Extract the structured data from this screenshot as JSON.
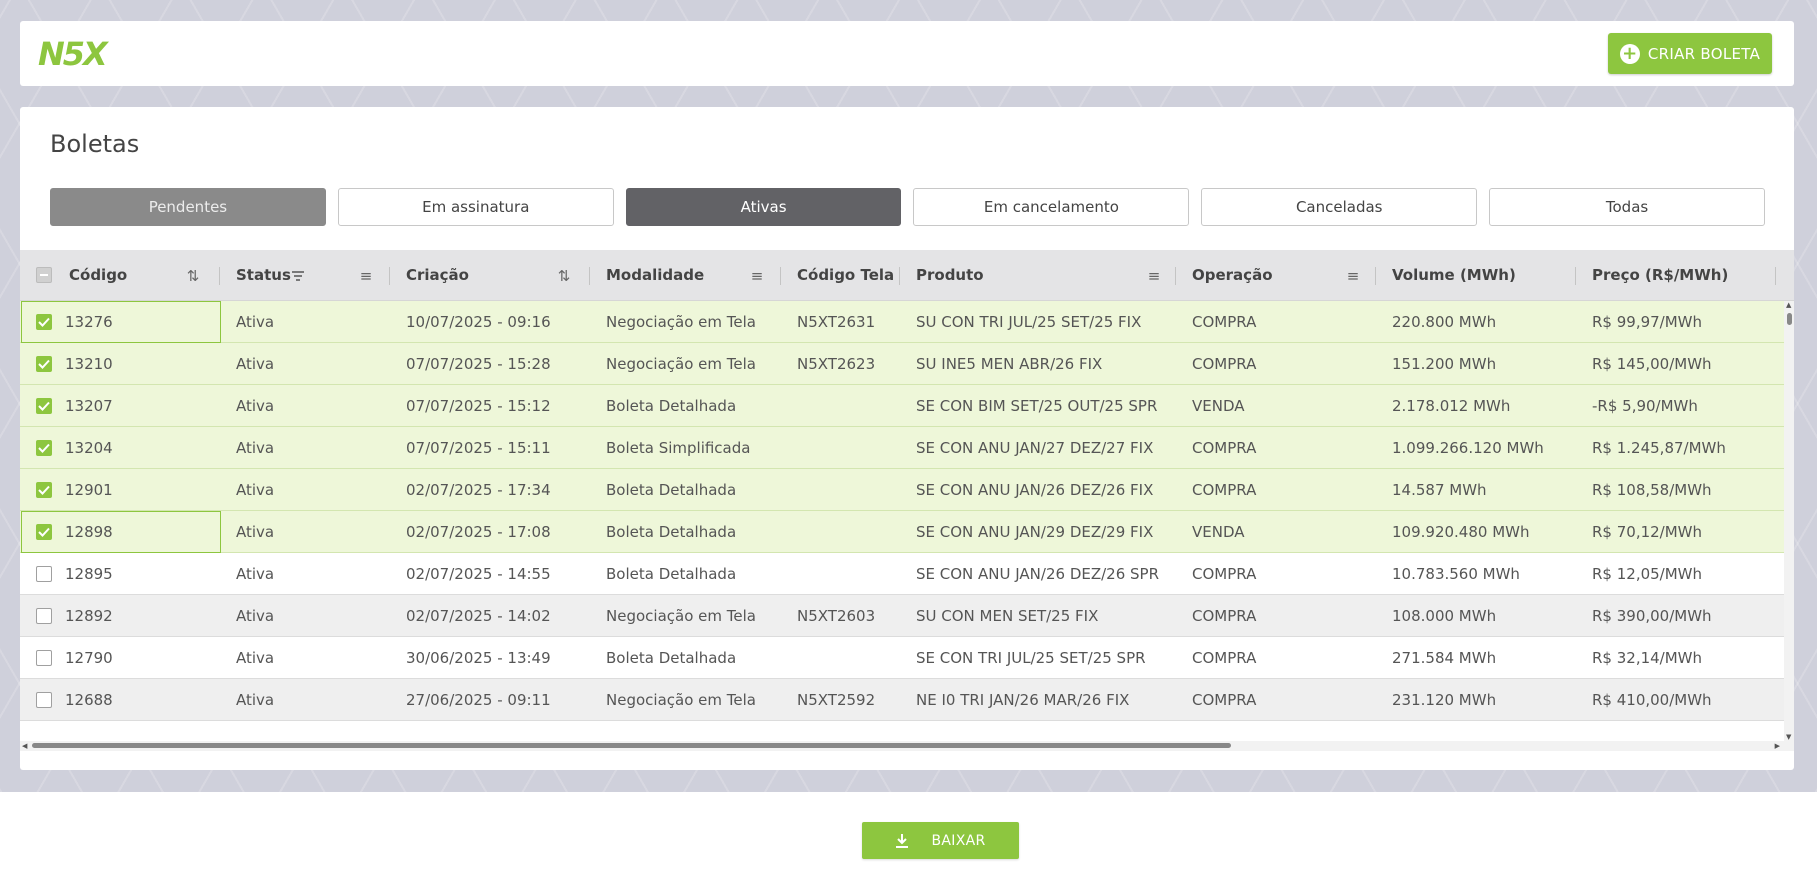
{
  "header": {
    "logo_text": "N5X",
    "create_button_label": "CRIAR BOLETA"
  },
  "page": {
    "title": "Boletas"
  },
  "tabs": [
    {
      "label": "Pendentes",
      "state": "pending"
    },
    {
      "label": "Em assinatura",
      "state": "default"
    },
    {
      "label": "Ativas",
      "state": "active"
    },
    {
      "label": "Em cancelamento",
      "state": "default"
    },
    {
      "label": "Canceladas",
      "state": "default"
    },
    {
      "label": "Todas",
      "state": "default"
    }
  ],
  "table": {
    "columns": [
      {
        "label": "Código",
        "icon": "sort-icon"
      },
      {
        "label": "Status",
        "icon": "filter-icon"
      },
      {
        "label": "Criação",
        "icon": "sort-icon"
      },
      {
        "label": "Modalidade",
        "icon": "menu-icon"
      },
      {
        "label": "Código Tela",
        "icon": ""
      },
      {
        "label": "Produto",
        "icon": "menu-icon"
      },
      {
        "label": "Operação",
        "icon": "menu-icon"
      },
      {
        "label": "Volume (MWh)",
        "icon": ""
      },
      {
        "label": "Preço (R$/MWh)",
        "icon": ""
      }
    ],
    "rows": [
      {
        "checked": true,
        "codigo": "13276",
        "status": "Ativa",
        "criacao": "10/07/2025 - 09:16",
        "modalidade": "Negociação em Tela",
        "codigo_tela": "N5XT2631",
        "produto": "SU CON TRI JUL/25 SET/25 FIX",
        "operacao": "COMPRA",
        "volume": "220.800 MWh",
        "preco": "R$ 99,97/MWh"
      },
      {
        "checked": true,
        "codigo": "13210",
        "status": "Ativa",
        "criacao": "07/07/2025 - 15:28",
        "modalidade": "Negociação em Tela",
        "codigo_tela": "N5XT2623",
        "produto": "SU INE5 MEN ABR/26 FIX",
        "operacao": "COMPRA",
        "volume": "151.200 MWh",
        "preco": "R$ 145,00/MWh"
      },
      {
        "checked": true,
        "codigo": "13207",
        "status": "Ativa",
        "criacao": "07/07/2025 - 15:12",
        "modalidade": "Boleta Detalhada",
        "codigo_tela": "",
        "produto": "SE CON BIM SET/25 OUT/25 SPR",
        "operacao": "VENDA",
        "volume": "2.178.012 MWh",
        "preco": "-R$ 5,90/MWh"
      },
      {
        "checked": true,
        "codigo": "13204",
        "status": "Ativa",
        "criacao": "07/07/2025 - 15:11",
        "modalidade": "Boleta Simplificada",
        "codigo_tela": "",
        "produto": "SE CON ANU JAN/27 DEZ/27 FIX",
        "operacao": "COMPRA",
        "volume": "1.099.266.120 MWh",
        "preco": "R$ 1.245,87/MWh"
      },
      {
        "checked": true,
        "codigo": "12901",
        "status": "Ativa",
        "criacao": "02/07/2025 - 17:34",
        "modalidade": "Boleta Detalhada",
        "codigo_tela": "",
        "produto": "SE CON ANU JAN/26 DEZ/26 FIX",
        "operacao": "COMPRA",
        "volume": "14.587 MWh",
        "preco": "R$ 108,58/MWh"
      },
      {
        "checked": true,
        "codigo": "12898",
        "status": "Ativa",
        "criacao": "02/07/2025 - 17:08",
        "modalidade": "Boleta Detalhada",
        "codigo_tela": "",
        "produto": "SE CON ANU JAN/29 DEZ/29 FIX",
        "operacao": "VENDA",
        "volume": "109.920.480 MWh",
        "preco": "R$ 70,12/MWh"
      },
      {
        "checked": false,
        "codigo": "12895",
        "status": "Ativa",
        "criacao": "02/07/2025 - 14:55",
        "modalidade": "Boleta Detalhada",
        "codigo_tela": "",
        "produto": "SE CON ANU JAN/26 DEZ/26 SPR",
        "operacao": "COMPRA",
        "volume": "10.783.560 MWh",
        "preco": "R$ 12,05/MWh"
      },
      {
        "checked": false,
        "codigo": "12892",
        "status": "Ativa",
        "criacao": "02/07/2025 - 14:02",
        "modalidade": "Negociação em Tela",
        "codigo_tela": "N5XT2603",
        "produto": "SU CON MEN SET/25 FIX",
        "operacao": "COMPRA",
        "volume": "108.000 MWh",
        "preco": "R$ 390,00/MWh"
      },
      {
        "checked": false,
        "codigo": "12790",
        "status": "Ativa",
        "criacao": "30/06/2025 - 13:49",
        "modalidade": "Boleta Detalhada",
        "codigo_tela": "",
        "produto": "SE CON TRI JUL/25 SET/25 SPR",
        "operacao": "COMPRA",
        "volume": "271.584 MWh",
        "preco": "R$ 32,14/MWh"
      },
      {
        "checked": false,
        "codigo": "12688",
        "status": "Ativa",
        "criacao": "27/06/2025 - 09:11",
        "modalidade": "Negociação em Tela",
        "codigo_tela": "N5XT2592",
        "produto": "NE I0 TRI JAN/26 MAR/26 FIX",
        "operacao": "COMPRA",
        "volume": "231.120 MWh",
        "preco": "R$ 410,00/MWh"
      }
    ]
  },
  "footer": {
    "download_button_label": "BAIXAR"
  },
  "colors": {
    "accent": "#8dc63f",
    "selected_row": "#eef7d9",
    "active_tab": "#626266",
    "pending_tab": "#8a8a8a"
  }
}
